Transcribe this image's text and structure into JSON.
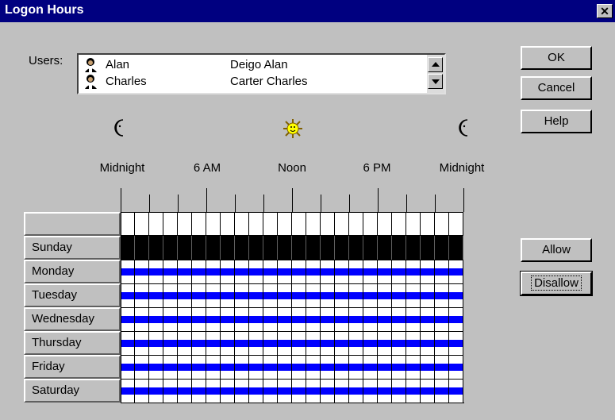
{
  "window": {
    "title": "Logon Hours",
    "close_glyph": "✕"
  },
  "users_label": "Users:",
  "users": [
    {
      "name": "Alan",
      "full_name": "Deigo Alan",
      "icon": "user-icon"
    },
    {
      "name": "Charles",
      "full_name": "Carter Charles",
      "icon": "user-icon"
    }
  ],
  "buttons": {
    "ok": "OK",
    "cancel": "Cancel",
    "help": "Help",
    "allow": "Allow",
    "disallow": "Disallow"
  },
  "time_icons": [
    "moon-icon",
    "sun-icon",
    "moon-icon"
  ],
  "time_labels": [
    "Midnight",
    "6 AM",
    "Noon",
    "6 PM",
    "Midnight"
  ],
  "days": [
    "Sunday",
    "Monday",
    "Tuesday",
    "Wednesday",
    "Thursday",
    "Friday",
    "Saturday"
  ],
  "schedule": {
    "hours_per_day": 24,
    "sunday": "selected",
    "other_days": "allowed"
  },
  "colors": {
    "titlebar": "#000080",
    "allowed": "#0000ff",
    "selected": "#000000",
    "window": "#c0c0c0"
  }
}
